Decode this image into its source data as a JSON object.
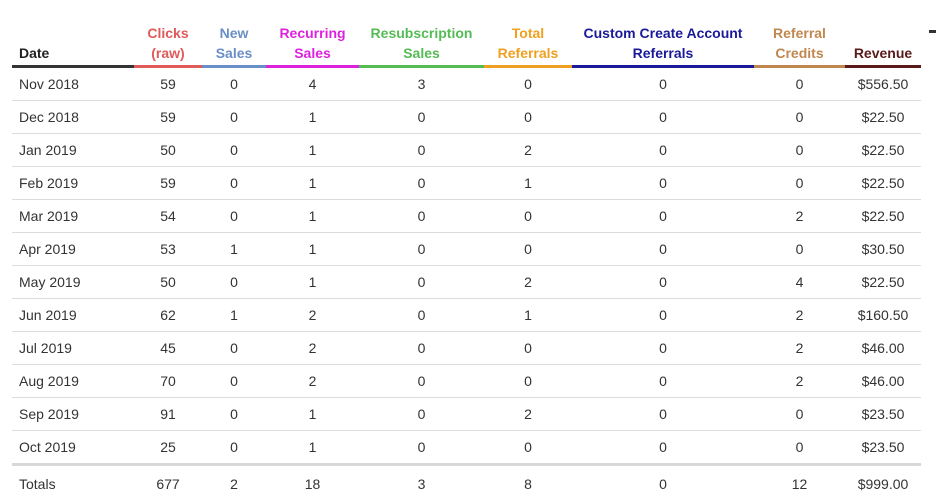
{
  "columns": [
    {
      "key": "date",
      "label": [
        "Date"
      ],
      "color": "#222222"
    },
    {
      "key": "clicks",
      "label": [
        "Clicks",
        "(raw)"
      ],
      "color": "#e05a5a"
    },
    {
      "key": "new_sales",
      "label": [
        "New",
        "Sales"
      ],
      "color": "#6a8fc7"
    },
    {
      "key": "recurring_sales",
      "label": [
        "Recurring",
        "Sales"
      ],
      "color": "#dd22dd"
    },
    {
      "key": "resub_sales",
      "label": [
        "Resubscription",
        "Sales"
      ],
      "color": "#55bb55"
    },
    {
      "key": "total_referrals",
      "label": [
        "Total",
        "Referrals"
      ],
      "color": "#f0a020"
    },
    {
      "key": "custom_create",
      "label": [
        "Custom Create Account",
        "Referrals"
      ],
      "color": "#1a1a99"
    },
    {
      "key": "referral_credits",
      "label": [
        "Referral",
        "Credits"
      ],
      "color": "#c08850"
    },
    {
      "key": "revenue",
      "label": [
        "Revenue"
      ],
      "color": "#5a1a1a"
    }
  ],
  "rows": [
    [
      "Nov 2018",
      "59",
      "0",
      "4",
      "3",
      "0",
      "0",
      "0",
      "$556.50"
    ],
    [
      "Dec 2018",
      "59",
      "0",
      "1",
      "0",
      "0",
      "0",
      "0",
      "$22.50"
    ],
    [
      "Jan 2019",
      "50",
      "0",
      "1",
      "0",
      "2",
      "0",
      "0",
      "$22.50"
    ],
    [
      "Feb 2019",
      "59",
      "0",
      "1",
      "0",
      "1",
      "0",
      "0",
      "$22.50"
    ],
    [
      "Mar 2019",
      "54",
      "0",
      "1",
      "0",
      "0",
      "0",
      "2",
      "$22.50"
    ],
    [
      "Apr 2019",
      "53",
      "1",
      "1",
      "0",
      "0",
      "0",
      "0",
      "$30.50"
    ],
    [
      "May 2019",
      "50",
      "0",
      "1",
      "0",
      "2",
      "0",
      "4",
      "$22.50"
    ],
    [
      "Jun 2019",
      "62",
      "1",
      "2",
      "0",
      "1",
      "0",
      "2",
      "$160.50"
    ],
    [
      "Jul 2019",
      "45",
      "0",
      "2",
      "0",
      "0",
      "0",
      "2",
      "$46.00"
    ],
    [
      "Aug 2019",
      "70",
      "0",
      "2",
      "0",
      "0",
      "0",
      "2",
      "$46.00"
    ],
    [
      "Sep 2019",
      "91",
      "0",
      "1",
      "0",
      "2",
      "0",
      "0",
      "$23.50"
    ],
    [
      "Oct 2019",
      "25",
      "0",
      "1",
      "0",
      "0",
      "0",
      "0",
      "$23.50"
    ]
  ],
  "totals": [
    "Totals",
    "677",
    "2",
    "18",
    "3",
    "8",
    "0",
    "12",
    "$999.00"
  ]
}
